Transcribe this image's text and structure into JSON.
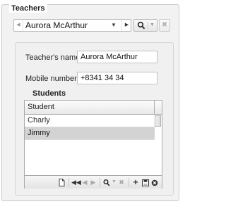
{
  "fieldset": {
    "legend": "Teachers"
  },
  "navigator": {
    "selected_value": "Aurora McArthur",
    "prev_icon": "triangle-left",
    "next_icon": "triangle-right",
    "dropdown_icon": "caret-down",
    "search_icon": "magnifier",
    "clear_icon": "x"
  },
  "form": {
    "teacher_name_label": "Teacher's name",
    "teacher_name_value": "Aurora McArthur",
    "mobile_label": "Mobile number",
    "mobile_value": "+8341 34 34"
  },
  "students": {
    "title": "Students",
    "columns": [
      "Student"
    ],
    "rows": [
      {
        "name": "Charly",
        "selected": false
      },
      {
        "name": "Jimmy",
        "selected": true
      }
    ],
    "toolbar_icons": [
      "new-document",
      "first",
      "previous",
      "next",
      "search",
      "search-dropdown",
      "clear",
      "add",
      "save",
      "delete"
    ]
  },
  "colors": {
    "frame_bg": "#f2f2f2",
    "selected_row": "#d3d3d3",
    "border": "#a9a9a9"
  }
}
